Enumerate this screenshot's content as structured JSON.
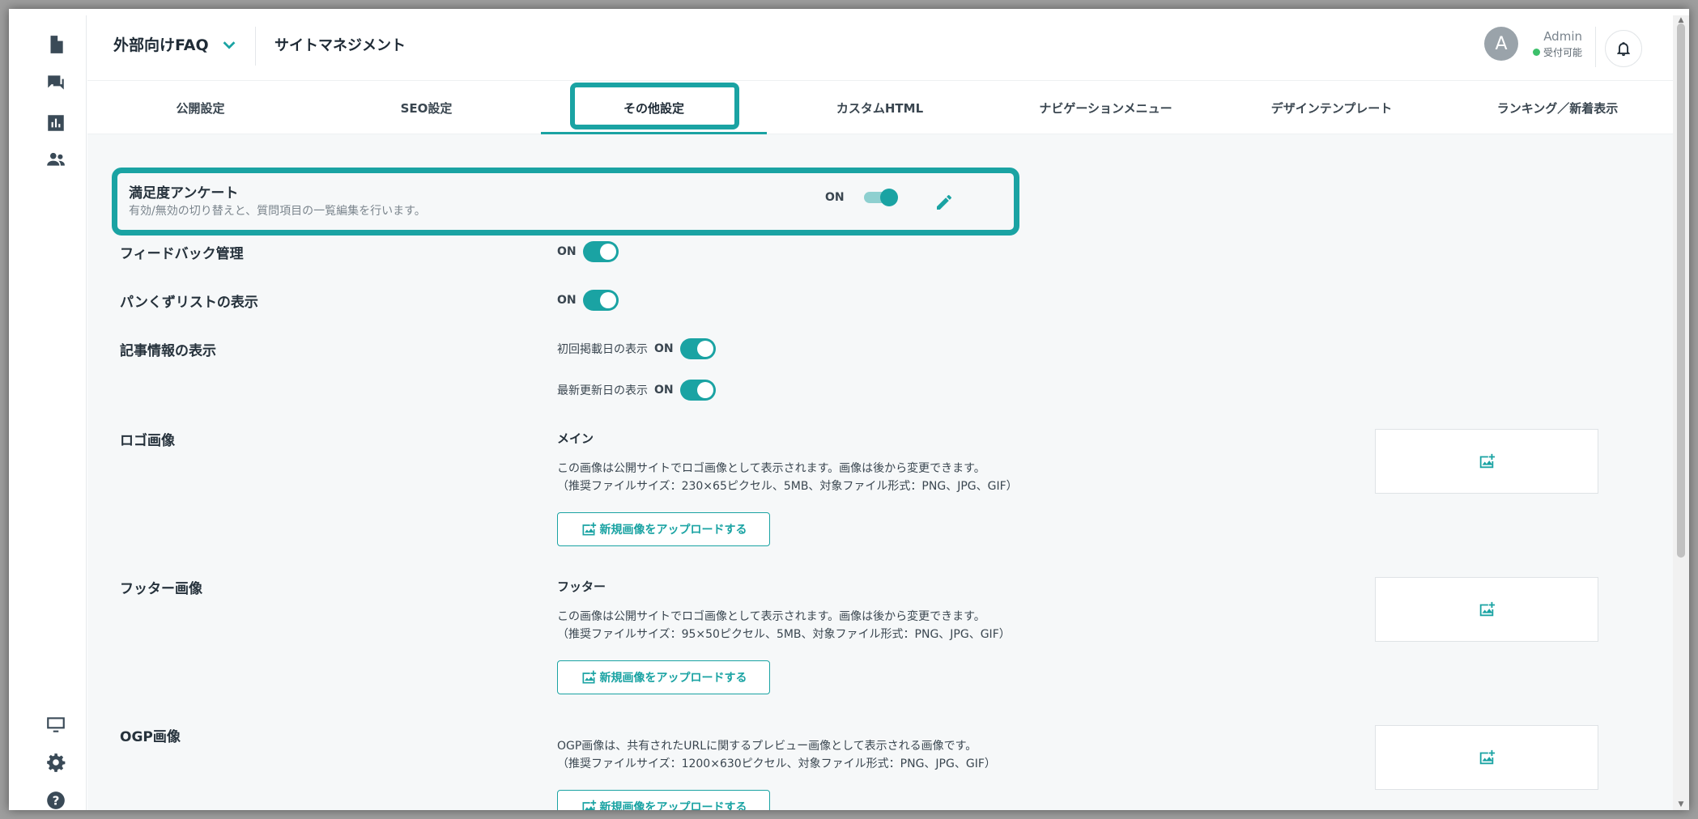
{
  "sidebar": {
    "icons": [
      "document-icon",
      "chat-icon",
      "chart-icon",
      "people-icon",
      "monitor-icon",
      "gear-icon",
      "help-icon"
    ]
  },
  "header": {
    "site_name": "外部向けFAQ",
    "title": "サイトマネジメント",
    "user_initial": "A",
    "user_name": "Admin",
    "user_status": "受付可能"
  },
  "tabs": [
    {
      "label": "公開設定"
    },
    {
      "label": "SEO設定"
    },
    {
      "label": "その他設定"
    },
    {
      "label": "カスタムHTML"
    },
    {
      "label": "ナビゲーションメニュー"
    },
    {
      "label": "デザインテンプレート"
    },
    {
      "label": "ランキング／新着表示"
    }
  ],
  "settings": {
    "survey": {
      "title": "満足度アンケート",
      "desc": "有効/無効の切り替えと、質問項目の一覧編集を行います。",
      "state": "ON"
    },
    "feedback": {
      "title": "フィードバック管理",
      "state": "ON"
    },
    "breadcrumb": {
      "title": "パンくずリストの表示",
      "state": "ON"
    },
    "article_info": {
      "title": "記事情報の表示",
      "first_label": "初回掲載日の表示",
      "first_state": "ON",
      "updated_label": "最新更新日の表示",
      "updated_state": "ON"
    },
    "logo": {
      "title": "ロゴ画像",
      "sub": "メイン",
      "desc1": "この画像は公開サイトでロゴ画像として表示されます。画像は後から変更できます。",
      "desc2": "（推奨ファイルサイズ：230×65ピクセル、5MB、対象ファイル形式：PNG、JPG、GIF）",
      "button": "新規画像をアップロードする"
    },
    "footer": {
      "title": "フッター画像",
      "sub": "フッター",
      "desc1": "この画像は公開サイトでロゴ画像として表示されます。画像は後から変更できます。",
      "desc2": "（推奨ファイルサイズ：95×50ピクセル、5MB、対象ファイル形式：PNG、JPG、GIF）",
      "button": "新規画像をアップロードする"
    },
    "ogp": {
      "title": "OGP画像",
      "desc1": "OGP画像は、共有されたURLに関するプレビュー画像として表示される画像です。",
      "desc2": "（推奨ファイルサイズ：1200×630ピクセル、対象ファイル形式：PNG、JPG、GIF）",
      "button": "新規画像をアップロードする"
    }
  },
  "colors": {
    "accent": "#1aa3a3",
    "status_online": "#3cc06a"
  }
}
